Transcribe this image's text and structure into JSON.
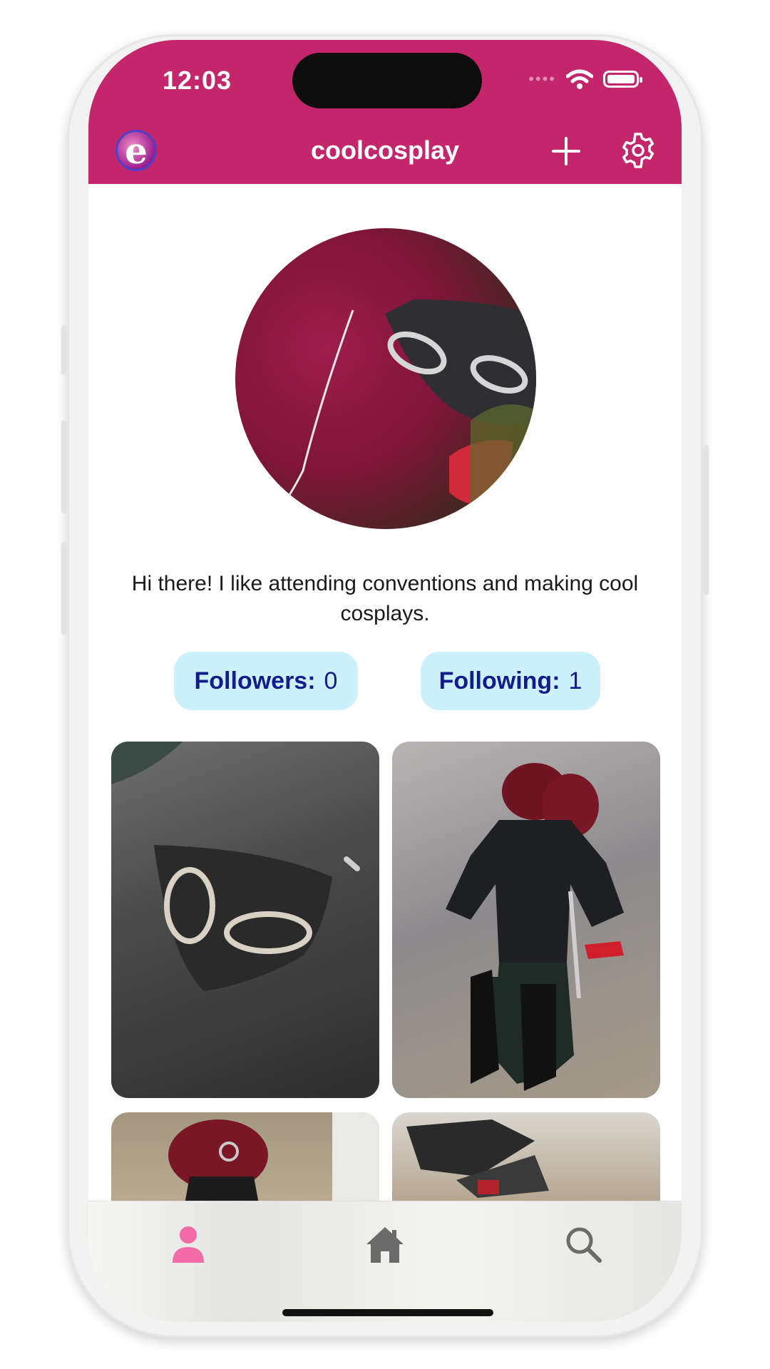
{
  "status_bar": {
    "time": "12:03",
    "signal": "••••"
  },
  "header": {
    "logo_letter": "e",
    "username": "coolcosplay",
    "add_icon": "plus-icon",
    "settings_icon": "gear-icon",
    "background_color": "#c4266c"
  },
  "profile": {
    "bio": "Hi there! I like attending conventions and making cool cosplays.",
    "followers": {
      "label": "Followers:",
      "count": "0"
    },
    "following": {
      "label": "Following:",
      "count": "1"
    },
    "pill_color": "#cdf1fb",
    "pill_text_color": "#121c8a"
  },
  "tab_bar": {
    "tabs": [
      {
        "icon": "person-icon",
        "active": true,
        "color": "#f26aa6"
      },
      {
        "icon": "home-icon",
        "active": false,
        "color": "#6b6b6b"
      },
      {
        "icon": "search-icon",
        "active": false,
        "color": "#6b6b6b"
      }
    ]
  }
}
